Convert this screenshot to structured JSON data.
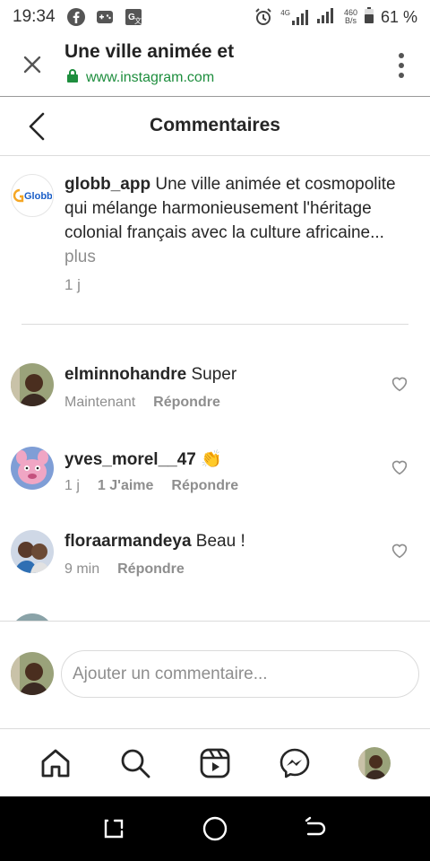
{
  "status_bar": {
    "time": "19:34",
    "network_top": "4G",
    "speed_value": "460",
    "speed_unit": "B/s",
    "battery": "61 %"
  },
  "browser": {
    "title": "Une ville animée et",
    "url": "www.instagram.com"
  },
  "header": {
    "title": "Commentaires"
  },
  "caption": {
    "username": "globb_app",
    "text": "Une ville animée et cosmopolite qui mélange harmonieusement l'héritage colonial français avec la culture africaine...",
    "more": "plus",
    "time": "1 j",
    "avatar_logo": "Globb"
  },
  "comments": [
    {
      "username": "elminnohandre",
      "text": "Super",
      "time": "Maintenant",
      "likes": "",
      "reply": "Répondre"
    },
    {
      "username": "yves_morel__47",
      "text": "👏",
      "time": "1 j",
      "likes": "1 J'aime",
      "reply": "Répondre"
    },
    {
      "username": "floraarmandeya",
      "text": "Beau !",
      "time": "9 min",
      "likes": "",
      "reply": "Répondre"
    }
  ],
  "input": {
    "placeholder": "Ajouter un commentaire..."
  },
  "bottom_nav": {
    "items": [
      "home-icon",
      "search-icon",
      "reels-icon",
      "messenger-icon",
      "profile-avatar"
    ]
  },
  "colors": {
    "url_green": "#1e8e3e",
    "text_primary": "#262626",
    "text_secondary": "#8e8e8e",
    "divider": "#dbdbdb"
  }
}
